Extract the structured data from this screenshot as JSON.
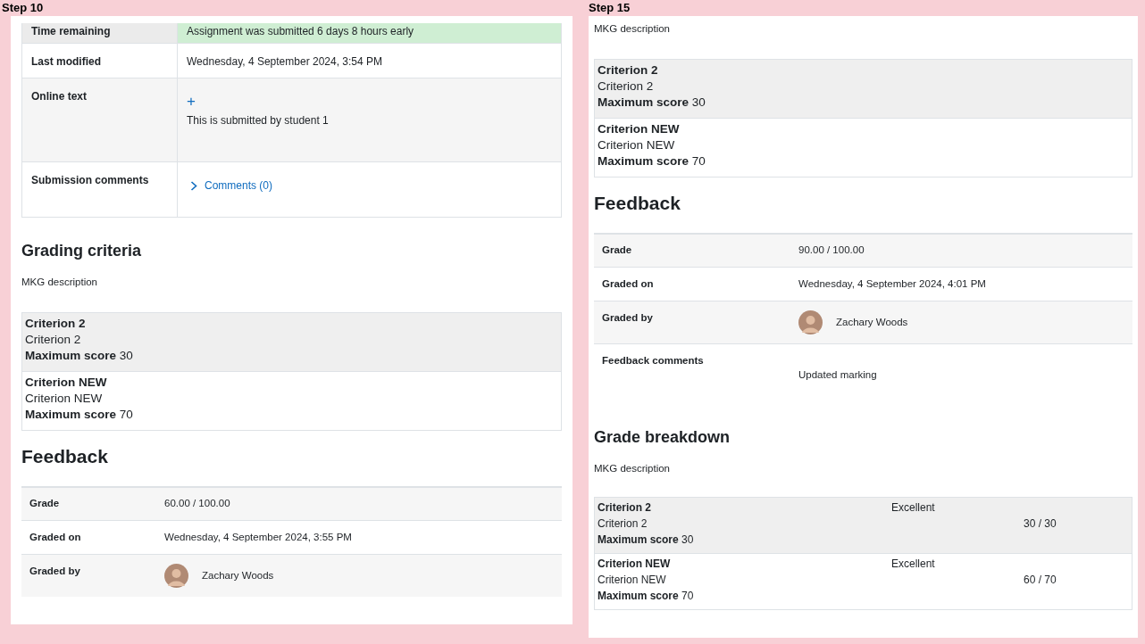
{
  "panels": [
    {
      "step": "Step 10",
      "submission_rows": [
        {
          "kind": "status",
          "label": "Time remaining",
          "value": "Assignment was submitted 6 days 8 hours early"
        },
        {
          "kind": "text",
          "label": "Last modified",
          "value": "Wednesday, 4 September 2024, 3:54 PM"
        },
        {
          "kind": "online_text",
          "label": "Online text",
          "icon": "+",
          "value": "This is submitted by student 1"
        },
        {
          "kind": "comments",
          "label": "Submission comments",
          "value": "Comments (0)",
          "expanded": false
        }
      ],
      "sections": [
        {
          "kind": "criteria",
          "heading": "Grading criteria",
          "description": "MKG description",
          "criteria": [
            {
              "title": "Criterion 2",
              "description": "Criterion 2",
              "max": "**Maximum score** 30"
            },
            {
              "title": "Criterion NEW",
              "description": "Criterion NEW",
              "max": "**Maximum score** 70"
            }
          ]
        },
        {
          "kind": "feedback",
          "heading": "Feedback",
          "rows": [
            {
              "kind": "text",
              "label": "Grade",
              "value": "60.00 / 100.00"
            },
            {
              "kind": "text",
              "label": "Graded on",
              "value": "Wednesday, 4 September 2024, 3:55 PM"
            },
            {
              "kind": "user",
              "label": "Graded by",
              "value": "Zachary Woods"
            }
          ]
        }
      ]
    },
    {
      "step": "Step 15",
      "sections": [
        {
          "kind": "criteria",
          "description": "MKG description",
          "criteria": [
            {
              "title": "Criterion 2",
              "description": "Criterion 2",
              "max": "**Maximum score** 30"
            },
            {
              "title": "Criterion NEW",
              "description": "Criterion NEW",
              "max": "**Maximum score** 70"
            }
          ]
        },
        {
          "kind": "feedback",
          "heading": "Feedback",
          "rows": [
            {
              "kind": "text",
              "label": "Grade",
              "value": "90.00 / 100.00"
            },
            {
              "kind": "text",
              "label": "Graded on",
              "value": "Wednesday, 4 September 2024, 4:01 PM"
            },
            {
              "kind": "user",
              "label": "Graded by",
              "value": "Zachary Woods"
            },
            {
              "kind": "comment",
              "label": "Feedback comments",
              "value": "Updated marking"
            }
          ]
        },
        {
          "kind": "breakdown",
          "heading": "Grade breakdown",
          "description": "MKG description",
          "criteria": [
            {
              "title": "Criterion 2",
              "description": "Criterion 2",
              "max": "**Maximum score** 30",
              "level": "Excellent",
              "score": "30 / 30"
            },
            {
              "title": "Criterion NEW",
              "description": "Criterion NEW",
              "max": "**Maximum score** 70",
              "level": "Excellent",
              "score": "60 / 70"
            }
          ]
        }
      ]
    }
  ]
}
